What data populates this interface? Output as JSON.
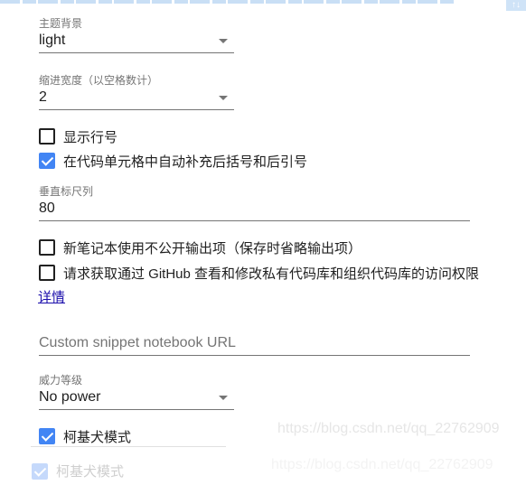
{
  "theme": {
    "label": "主题背景",
    "value": "light"
  },
  "indent": {
    "label": "缩进宽度（以空格数计）",
    "value": "2"
  },
  "checkboxes": [
    {
      "label": "显示行号",
      "checked": false
    },
    {
      "label": "在代码单元格中自动补充后括号和后引号",
      "checked": true
    }
  ],
  "ruler": {
    "label": "垂直标尺列",
    "value": "80"
  },
  "checkboxes2": [
    {
      "label": "新笔记本使用不公开输出项（保存时省略输出项）",
      "checked": false
    },
    {
      "label": "请求获取通过 GitHub 查看和修改私有代码库和组织代码库的访问权限",
      "checked": false
    }
  ],
  "details_link": "详情",
  "snippet": {
    "placeholder": "Custom snippet notebook URL",
    "value": ""
  },
  "power": {
    "label": "威力等级",
    "value": "No power"
  },
  "corgi": {
    "label": "柯基犬模式",
    "checked": true
  },
  "ghost_corgi": {
    "label": "柯基犬模式",
    "checked": true
  },
  "watermark": "https://blog.csdn.net/qq_22762909",
  "corner_glyph": "↑↓",
  "colors": {
    "accent": "#4285f4",
    "link": "#1a0dab"
  }
}
